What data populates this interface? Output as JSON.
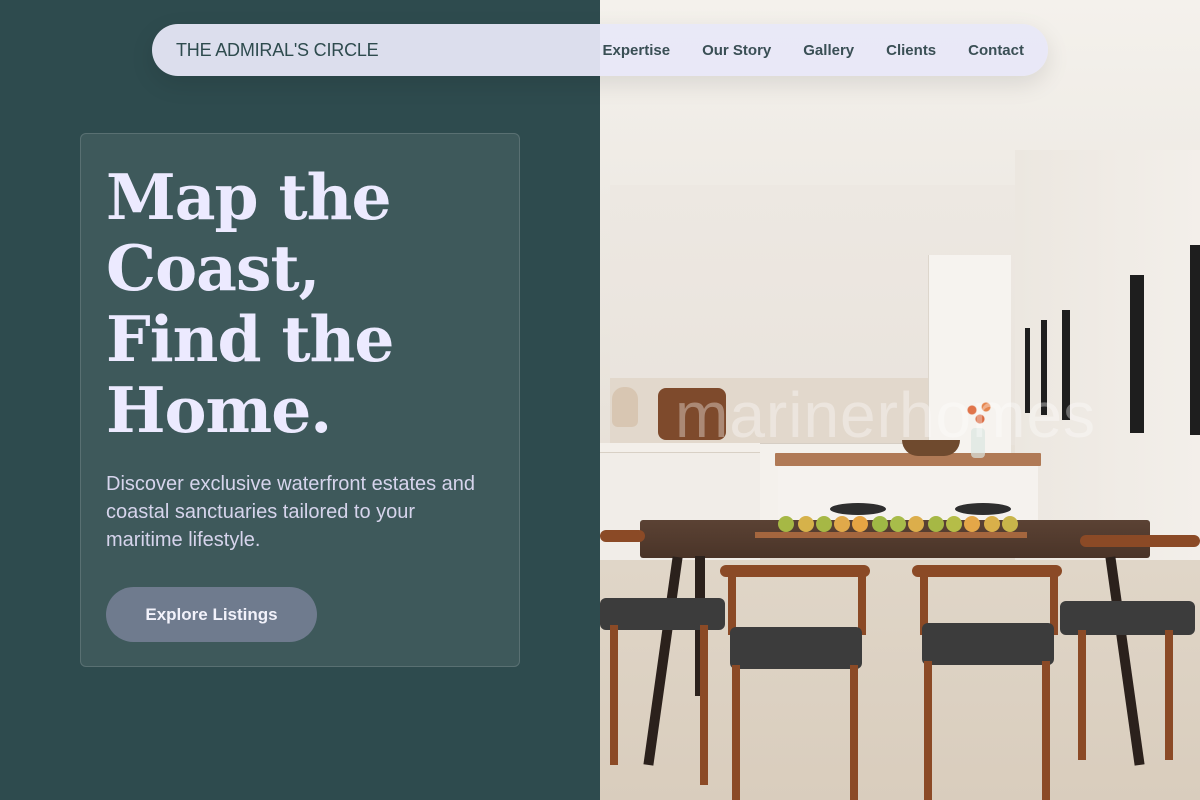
{
  "brand": {
    "name": "THE ADMIRAL'S CIRCLE"
  },
  "nav": {
    "items": [
      {
        "label": "Expertise"
      },
      {
        "label": "Our Story"
      },
      {
        "label": "Gallery"
      },
      {
        "label": "Clients"
      },
      {
        "label": "Contact"
      }
    ]
  },
  "hero": {
    "title_lines": [
      "Map the",
      "Coast,",
      "Find the",
      "Home."
    ],
    "subtitle": "Discover exclusive waterfront estates and coastal sanctuaries tailored to your maritime lifestyle.",
    "cta_label": "Explore Listings"
  },
  "photo": {
    "watermark": "marinerhomes"
  },
  "colors": {
    "left_panel_bg": "#2e4b4e",
    "navbar_bg": "#e8e8f8",
    "title_text": "#eceaff",
    "cta_bg": "#6f7b8e"
  }
}
